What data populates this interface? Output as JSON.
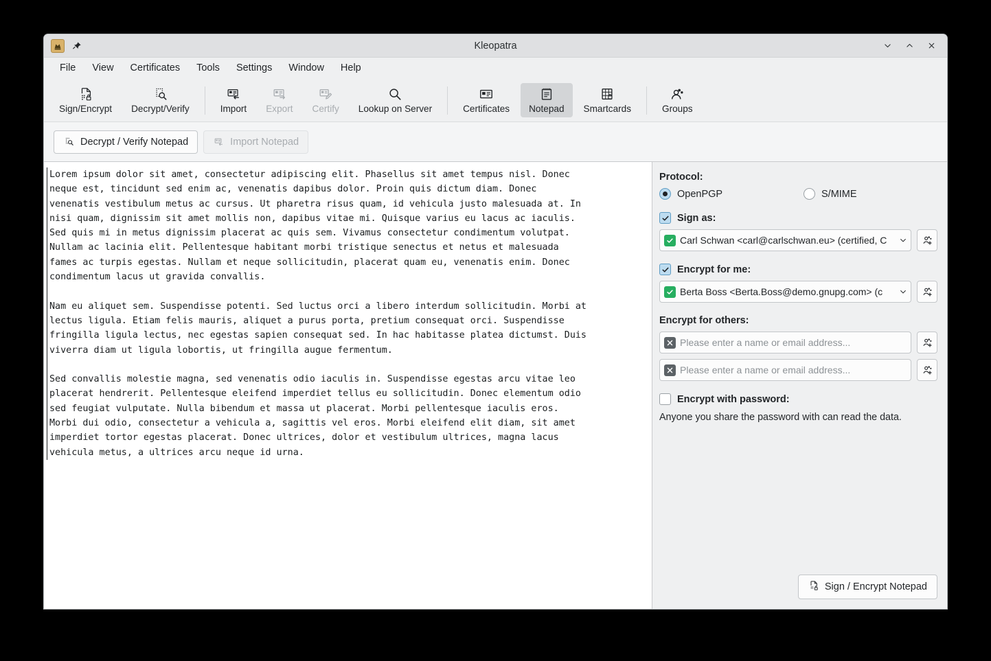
{
  "window": {
    "title": "Kleopatra",
    "app_icon": "kleopatra-icon",
    "pin_icon": "pin-icon",
    "controls": [
      {
        "name": "minimize-button",
        "glyph": "∨"
      },
      {
        "name": "maximize-button",
        "glyph": "∧"
      },
      {
        "name": "close-button",
        "glyph": "✕"
      }
    ]
  },
  "menubar": {
    "items": [
      {
        "label": "File"
      },
      {
        "label": "View"
      },
      {
        "label": "Certificates"
      },
      {
        "label": "Tools"
      },
      {
        "label": "Settings"
      },
      {
        "label": "Window"
      },
      {
        "label": "Help"
      }
    ]
  },
  "toolbar": {
    "groups": [
      {
        "items": [
          {
            "label": "Sign/Encrypt",
            "icon": "sign-encrypt-icon",
            "state": "enabled"
          },
          {
            "label": "Decrypt/Verify",
            "icon": "decrypt-verify-icon",
            "state": "enabled"
          }
        ]
      },
      {
        "items": [
          {
            "label": "Import",
            "icon": "import-icon",
            "state": "enabled"
          },
          {
            "label": "Export",
            "icon": "export-icon",
            "state": "disabled"
          },
          {
            "label": "Certify",
            "icon": "certify-icon",
            "state": "disabled"
          },
          {
            "label": "Lookup on Server",
            "icon": "search-icon",
            "state": "enabled"
          }
        ]
      },
      {
        "items": [
          {
            "label": "Certificates",
            "icon": "certificates-icon",
            "state": "enabled"
          },
          {
            "label": "Notepad",
            "icon": "notepad-icon",
            "state": "active"
          },
          {
            "label": "Smartcards",
            "icon": "smartcard-icon",
            "state": "enabled"
          },
          {
            "label": "Groups",
            "icon": "groups-icon",
            "state": "enabled"
          }
        ]
      }
    ]
  },
  "actionbar": {
    "decrypt_verify": {
      "label": "Decrypt / Verify Notepad",
      "icon": "decrypt-verify-icon"
    },
    "import": {
      "label": "Import Notepad",
      "icon": "import-icon"
    }
  },
  "notepad": {
    "text": "Lorem ipsum dolor sit amet, consectetur adipiscing elit. Phasellus sit amet tempus nisl. Donec\nneque est, tincidunt sed enim ac, venenatis dapibus dolor. Proin quis dictum diam. Donec\nvenenatis vestibulum metus ac cursus. Ut pharetra risus quam, id vehicula justo malesuada at. In\nnisi quam, dignissim sit amet mollis non, dapibus vitae mi. Quisque varius eu lacus ac iaculis.\nSed quis mi in metus dignissim placerat ac quis sem. Vivamus consectetur condimentum volutpat.\nNullam ac lacinia elit. Pellentesque habitant morbi tristique senectus et netus et malesuada\nfames ac turpis egestas. Nullam et neque sollicitudin, placerat quam eu, venenatis enim. Donec\ncondimentum lacus ut gravida convallis.\n\nNam eu aliquet sem. Suspendisse potenti. Sed luctus orci a libero interdum sollicitudin. Morbi at\nlectus ligula. Etiam felis mauris, aliquet a purus porta, pretium consequat orci. Suspendisse\nfringilla ligula lectus, nec egestas sapien consequat sed. In hac habitasse platea dictumst. Duis\nviverra diam ut ligula lobortis, ut fringilla augue fermentum.\n\nSed convallis molestie magna, sed venenatis odio iaculis in. Suspendisse egestas arcu vitae leo\nplacerat hendrerit. Pellentesque eleifend imperdiet tellus eu sollicitudin. Donec elementum odio\nsed feugiat vulputate. Nulla bibendum et massa ut placerat. Morbi pellentesque iaculis eros.\nMorbi dui odio, consectetur a vehicula a, sagittis vel eros. Morbi eleifend elit diam, sit amet\nimperdiet tortor egestas placerat. Donec ultrices, dolor et vestibulum ultrices, magna lacus\nvehicula metus, a ultrices arcu neque id urna."
  },
  "sidebar": {
    "protocol": {
      "label": "Protocol:",
      "options": [
        {
          "label": "OpenPGP",
          "selected": true
        },
        {
          "label": "S/MIME",
          "selected": false
        }
      ]
    },
    "sign_as": {
      "label": "Sign as:",
      "checked": true,
      "value": "Carl Schwan <carl@carlschwan.eu> (certified, C",
      "status_icon": "certified-check-icon",
      "picker_icon": "add-recipient-icon"
    },
    "encrypt_for_me": {
      "label": "Encrypt for me:",
      "checked": true,
      "value": "Berta Boss <Berta.Boss@demo.gnupg.com> (c",
      "status_icon": "certified-check-icon",
      "picker_icon": "add-recipient-icon"
    },
    "encrypt_for_others": {
      "label": "Encrypt for others:",
      "fields": [
        {
          "placeholder": "Please enter a name or email address...",
          "value": "",
          "status_icon": "no-certificate-icon",
          "picker_icon": "add-recipient-icon"
        },
        {
          "placeholder": "Please enter a name or email address...",
          "value": "",
          "status_icon": "no-certificate-icon",
          "picker_icon": "add-recipient-icon"
        }
      ]
    },
    "encrypt_with_password": {
      "label": "Encrypt with password:",
      "checked": false,
      "hint": "Anyone you share the password with can read the data."
    },
    "sign_encrypt_button": {
      "label": "Sign / Encrypt Notepad",
      "icon": "sign-encrypt-icon"
    }
  },
  "colors": {
    "window_bg": "#eff0f1",
    "titlebar_bg": "#dfe0e2",
    "accent_check": "#bddcf0",
    "status_ok": "#27ae60",
    "status_none": "#5c6266",
    "text": "#232629",
    "disabled_text": "#a8acb0"
  }
}
